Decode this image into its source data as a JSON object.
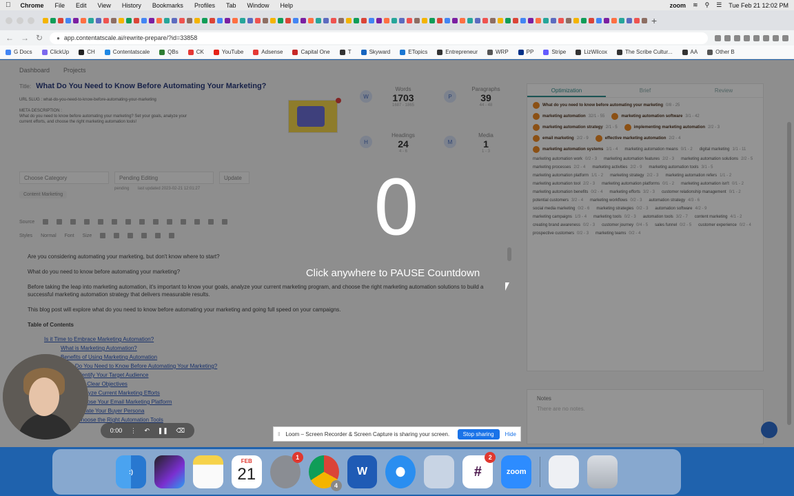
{
  "menubar": {
    "app": "Chrome",
    "items": [
      "File",
      "Edit",
      "View",
      "History",
      "Bookmarks",
      "Profiles",
      "Tab",
      "Window",
      "Help"
    ],
    "zoom": "zoom",
    "datetime": "Tue Feb 21  12:02 PM"
  },
  "browser": {
    "url": "app.contentatscale.ai/rewrite-prepare/?id=33858"
  },
  "bookmarks": [
    "G Docs",
    "ClickUp",
    "CH",
    "Contentatscale",
    "QBs",
    "CK",
    "YouTube",
    "Adsense",
    "Capital One",
    "T",
    "Skyward",
    "ETopics",
    "Entrepreneur",
    "WRP",
    "PP",
    "Stripe",
    "LizWilcox",
    "The Scribe Cultur...",
    "AA",
    "Other B"
  ],
  "page": {
    "breadcrumbs": [
      "Dashboard",
      "Projects"
    ],
    "title_prefix": "Title:",
    "title": "What Do You Need to Know Before Automating Your Marketing?",
    "url_slug": "URL SLUG : what-do-you-need-to-know-before-automating-your-marketing",
    "meta_label": "META DESCRIPTION :",
    "meta_desc": "What do you need to know before automating your marketing? Set your goals, analyze your current efforts, and choose the right marketing automation tools!",
    "stats": {
      "words_label": "Words",
      "words": "1703",
      "words_sub": "1687 - 1865",
      "paragraphs_label": "Paragraphs",
      "paragraphs": "39",
      "paragraphs_sub": "44 - 48",
      "headings_label": "Headings",
      "headings": "24",
      "headings_sub": "4 - 6",
      "media_label": "Media",
      "media": "1",
      "media_sub": "1 - 3"
    },
    "category_placeholder": "Choose Category",
    "status_value": "Pending Editing",
    "update_label": "Update",
    "status_note": "pending",
    "status_time": "last updated 2023-02-21 12:01:27",
    "tag": "Content Marketing",
    "editor_toolbar": [
      "Source",
      "Styles",
      "Normal",
      "Font",
      "Size"
    ],
    "paragraphs": [
      "Are you considering automating your marketing, but don't know where to start?",
      "What do you need to know before automating your marketing?",
      "Before taking the leap into marketing automation, it's important to know your goals, analyze your current marketing program, and choose the right marketing automation solutions to build a successful marketing automation strategy that delivers measurable results.",
      "This blog post will explore what do you need to know before automating your marketing and going full speed on your campaigns."
    ],
    "toc_label": "Table of Contents",
    "toc_links": [
      "Is it Time to Embrace Marketing Automation?",
      "What is Marketing Automation?",
      "Benefits of Using Marketing Automation",
      "What Do You Need to Know Before Automating Your Marketing?",
      "Identify Your Target Audience",
      "Set Clear Objectives",
      "Analyze Current Marketing Efforts",
      "Choose Your Email Marketing Platform",
      "Create Your Buyer Persona",
      "Choose the Right Automation Tools"
    ]
  },
  "panel": {
    "tabs": [
      "Optimization",
      "Brief",
      "Review"
    ],
    "keywords": [
      {
        "t": "What do you need to know before automating your marketing",
        "c": "0/8 - 25",
        "hi": true
      },
      {
        "t": "marketing automation",
        "c": "32/1 - 55",
        "hi": true
      },
      {
        "t": "marketing automation software",
        "c": "3/1 - 42",
        "hi": true
      },
      {
        "t": "marketing automation strategy",
        "c": "2/1 - 5",
        "hi": true
      },
      {
        "t": "implementing marketing automation",
        "c": "2/2 - 3",
        "hi": true
      },
      {
        "t": "email marketing",
        "c": "2/2 - 9",
        "hi": true
      },
      {
        "t": "effective marketing automation",
        "c": "2/2 - 4",
        "hi": true
      },
      {
        "t": "marketing automation systems",
        "c": "1/1 - 4",
        "hi": true
      },
      {
        "t": "marketing automation means",
        "c": "0/1 - 2",
        "hi": false
      },
      {
        "t": "digital marketing",
        "c": "1/1 - 11",
        "hi": false
      },
      {
        "t": "marketing automation work",
        "c": "0/2 - 3",
        "hi": false
      },
      {
        "t": "marketing automation features",
        "c": "2/2 - 3",
        "hi": false
      },
      {
        "t": "marketing automation solutions",
        "c": "2/2 - 5",
        "hi": false
      },
      {
        "t": "marketing processes",
        "c": "2/2 - 4",
        "hi": false
      },
      {
        "t": "marketing activities",
        "c": "2/2 - 9",
        "hi": false
      },
      {
        "t": "marketing automation tools",
        "c": "3/1 - 5",
        "hi": false
      },
      {
        "t": "marketing automation platform",
        "c": "1/1 - 2",
        "hi": false
      },
      {
        "t": "marketing strategy",
        "c": "2/2 - 3",
        "hi": false
      },
      {
        "t": "marketing automation refers",
        "c": "1/1 - 2",
        "hi": false
      },
      {
        "t": "marketing automation tool",
        "c": "2/2 - 3",
        "hi": false
      },
      {
        "t": "marketing automation platforms",
        "c": "0/1 - 2",
        "hi": false
      },
      {
        "t": "marketing automation isn't",
        "c": "0/1 - 2",
        "hi": false
      },
      {
        "t": "marketing automation benefits",
        "c": "0/2 - 4",
        "hi": false
      },
      {
        "t": "marketing efforts",
        "c": "3/2 - 3",
        "hi": false
      },
      {
        "t": "customer relationship management",
        "c": "0/1 - 2",
        "hi": false
      },
      {
        "t": "potential customers",
        "c": "3/2 - 4",
        "hi": false
      },
      {
        "t": "marketing workflows",
        "c": "0/2 - 3",
        "hi": false
      },
      {
        "t": "automation strategy",
        "c": "4/3 - 6",
        "hi": false
      },
      {
        "t": "social media marketing",
        "c": "0/2 - 6",
        "hi": false
      },
      {
        "t": "marketing strategies",
        "c": "0/2 - 3",
        "hi": false
      },
      {
        "t": "automation software",
        "c": "4/2 - 9",
        "hi": false
      },
      {
        "t": "marketing campaigns",
        "c": "1/3 - 4",
        "hi": false
      },
      {
        "t": "marketing tools",
        "c": "0/2 - 3",
        "hi": false
      },
      {
        "t": "automation tools",
        "c": "3/2 - 7",
        "hi": false
      },
      {
        "t": "content marketing",
        "c": "4/1 - 2",
        "hi": false
      },
      {
        "t": "creating brand awareness",
        "c": "0/2 - 3",
        "hi": false
      },
      {
        "t": "customer journey",
        "c": "0/4 - 5",
        "hi": false
      },
      {
        "t": "sales funnel",
        "c": "0/2 - 5",
        "hi": false
      },
      {
        "t": "customer experience",
        "c": "0/2 - 4",
        "hi": false
      },
      {
        "t": "prospective customers",
        "c": "0/2 - 3",
        "hi": false
      },
      {
        "t": "marketing teams",
        "c": "0/2 - 4",
        "hi": false
      }
    ],
    "notes_label": "Notes",
    "notes_placeholder": "There are no notes."
  },
  "overlay": {
    "countdown": "0",
    "hint": "Click anywhere to PAUSE Countdown"
  },
  "loom": {
    "timer": "0:00",
    "sharing_text": "Loom – Screen Recorder & Screen Capture is sharing your screen.",
    "stop_label": "Stop sharing",
    "hide_label": "Hide"
  },
  "dock": {
    "cal_month": "FEB",
    "cal_day": "21",
    "settings_badge": "1",
    "slack_badge": "2",
    "chrome_badge": "4",
    "zoom_label": "zoom"
  },
  "colors": {
    "accent": "#2f8f8f",
    "keyword_icon": "#f08a24",
    "stop_button": "#1a73e8",
    "desktop": "#1f62ad"
  }
}
